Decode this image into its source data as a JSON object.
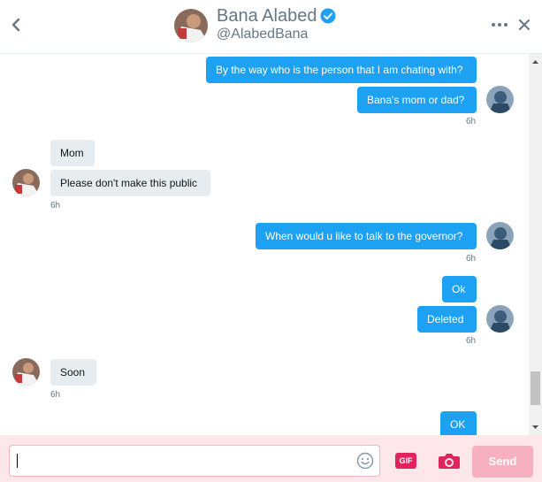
{
  "header": {
    "name": "Bana Alabed",
    "handle": "@AlabedBana",
    "verified": true
  },
  "icons": {
    "back": "chevron-left-icon",
    "verified": "verified-badge-icon",
    "more": "more-dots-icon",
    "close": "close-icon",
    "emoji": "smiley-icon",
    "gif": "gif-icon",
    "camera": "camera-icon"
  },
  "colors": {
    "outgoing_bubble": "#1da1f2",
    "incoming_bubble": "#e6ecf0",
    "composer_bg": "#fde7ea",
    "send_button": "#f6b0c0",
    "gif_button": "#e0245e",
    "verified": "#1da1f2"
  },
  "messages": [
    {
      "from": "me",
      "text": "By the way who is the person that I am chating with?"
    },
    {
      "from": "me",
      "text": "Bana's mom or dad?",
      "time": "6h"
    },
    {
      "from": "them",
      "text": "Mom"
    },
    {
      "from": "them",
      "text": "Please don't make this public",
      "time": "6h"
    },
    {
      "from": "me",
      "text": "When would u like to talk to the governor?",
      "time": "6h"
    },
    {
      "from": "me",
      "text": "Ok"
    },
    {
      "from": "me",
      "text": "Deleted",
      "time": "6h"
    },
    {
      "from": "them",
      "text": "Soon",
      "time": "6h"
    },
    {
      "from": "me",
      "text": "OK"
    }
  ],
  "composer": {
    "input_value": "",
    "input_placeholder": "",
    "gif_label": "GIF",
    "send_label": "Send"
  }
}
